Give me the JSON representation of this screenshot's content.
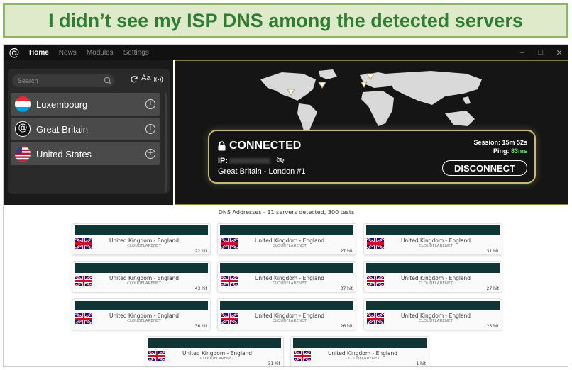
{
  "banner": {
    "text": "I didn’t see my ISP DNS among the detected servers"
  },
  "app": {
    "nav": {
      "home": "Home",
      "news": "News",
      "modules": "Modules",
      "settings": "Settings"
    },
    "window": {
      "minimize": "–",
      "maximize": "□",
      "close": "✕"
    },
    "sidebar": {
      "search_placeholder": "Search",
      "font_toggle": "Aa",
      "countries": [
        {
          "label": "Luxembourg",
          "flag": "luxembourg"
        },
        {
          "label": "Great Britain",
          "flag": "gb-logo"
        },
        {
          "label": "United States",
          "flag": "usa"
        }
      ]
    },
    "status": {
      "state": "CONNECTED",
      "ip_label": "IP:",
      "server": "Great Britain - London #1",
      "session_label": "Session:",
      "session_value": "15m 52s",
      "ping_label": "Ping:",
      "ping_value": "83ms",
      "disconnect_label": "DISCONNECT"
    },
    "colors": {
      "accent_gold": "#c9b878",
      "ping_green": "#6be06b",
      "dns_header": "#0f3535"
    }
  },
  "dns": {
    "title": "DNS Addresses - 11 servers detected, 300 tests",
    "servers": [
      {
        "location": "United Kingdom - England",
        "isp": "CLOUDFLARENET",
        "hits": "22 hit"
      },
      {
        "location": "United Kingdom - England",
        "isp": "CLOUDFLARENET",
        "hits": "27 hit"
      },
      {
        "location": "United Kingdom - England",
        "isp": "CLOUDFLARENET",
        "hits": "31 hit"
      },
      {
        "location": "United Kingdom - England",
        "isp": "CLOUDFLARENET",
        "hits": "43 hit"
      },
      {
        "location": "United Kingdom - England",
        "isp": "CLOUDFLARENET",
        "hits": "37 hit"
      },
      {
        "location": "United Kingdom - England",
        "isp": "CLOUDFLARENET",
        "hits": "27 hit"
      },
      {
        "location": "United Kingdom - England",
        "isp": "CLOUDFLARENET",
        "hits": "36 hit"
      },
      {
        "location": "United Kingdom - England",
        "isp": "CLOUDFLARENET",
        "hits": "26 hit"
      },
      {
        "location": "United Kingdom - England",
        "isp": "CLOUDFLARENET",
        "hits": "23 hit"
      },
      {
        "location": "United Kingdom - England",
        "isp": "CLOUDFLARENET",
        "hits": "31 hit"
      },
      {
        "location": "United Kingdom - England",
        "isp": "CLOUDFLARENET",
        "hits": "1 hit"
      }
    ]
  }
}
